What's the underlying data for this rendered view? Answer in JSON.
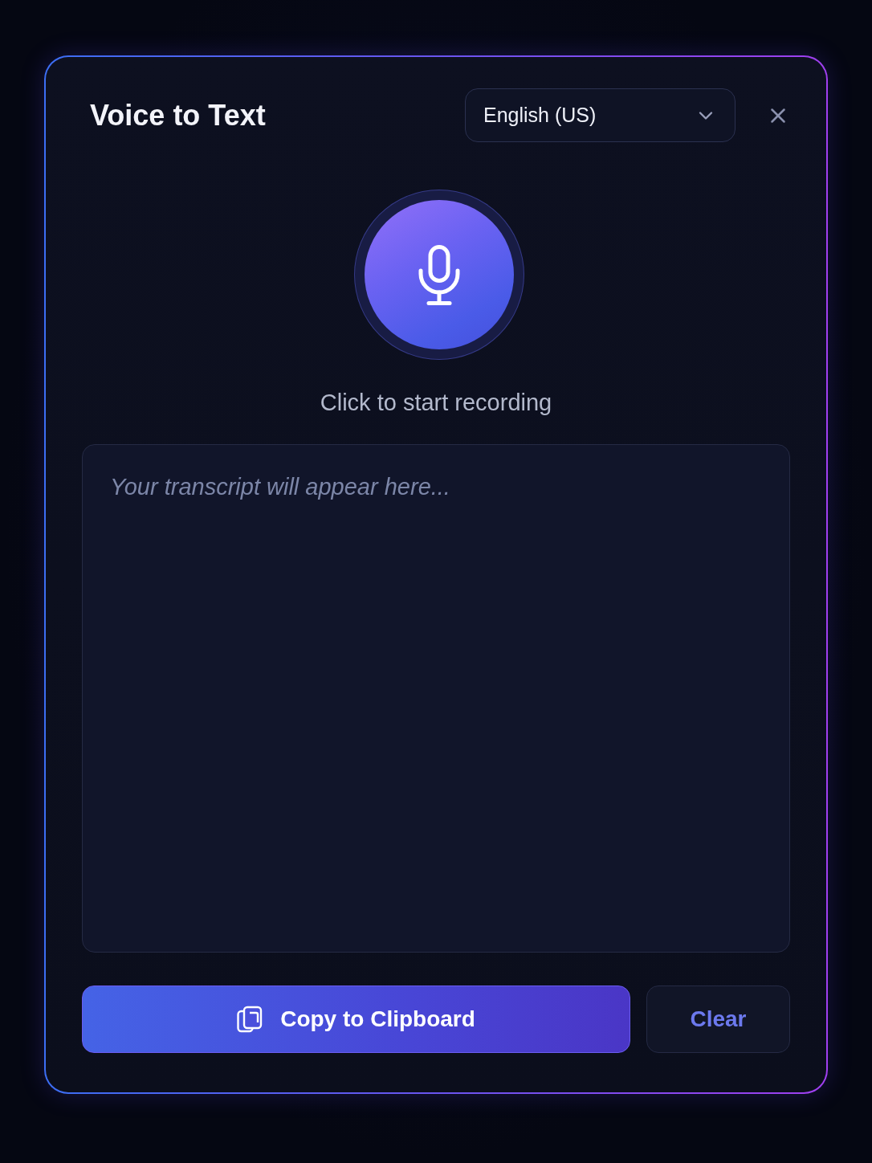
{
  "dialog": {
    "title": "Voice to Text",
    "language_select": {
      "value": "English (US)"
    },
    "status": "Click to start recording",
    "transcript": {
      "placeholder": "Your transcript will appear here..."
    },
    "buttons": [
      {
        "label": "Copy to Clipboard",
        "kind": "primary"
      },
      {
        "label": "Clear",
        "kind": "secondary"
      }
    ]
  }
}
